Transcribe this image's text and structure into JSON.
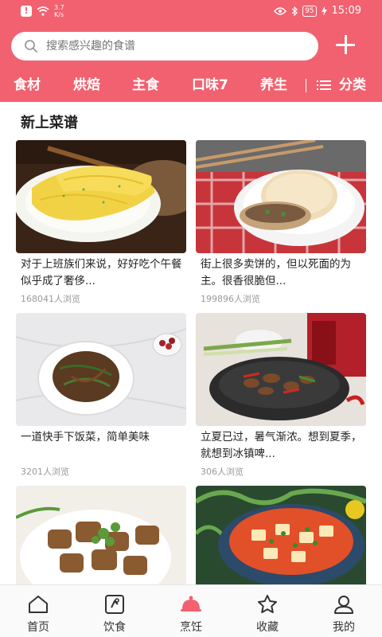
{
  "status_bar": {
    "speed_value": "3.7",
    "speed_unit": "K/s",
    "battery": "95",
    "time": "15:09"
  },
  "search": {
    "placeholder": "搜索感兴趣的食谱"
  },
  "tabs": [
    {
      "label": "食材"
    },
    {
      "label": "烘焙"
    },
    {
      "label": "主食"
    },
    {
      "label": "口味7"
    },
    {
      "label": "养生"
    }
  ],
  "category_label": "分类",
  "section_title": "新上菜谱",
  "recipes": [
    {
      "title": "对于上班族们来说，好好吃个午餐似乎成了奢侈...",
      "views": "168041人浏览"
    },
    {
      "title": "街上很多卖饼的，但以死面的为主。很香很脆但...",
      "views": "199896人浏览"
    },
    {
      "title": "一道快手下饭菜，简单美味",
      "views": "3201人浏览"
    },
    {
      "title": "立夏已过，暑气渐浓。想到夏季，就想到冰镇啤...",
      "views": "306人浏览"
    },
    {
      "title": "",
      "views": ""
    },
    {
      "title": "",
      "views": ""
    }
  ],
  "nav": [
    {
      "label": "首页"
    },
    {
      "label": "饮食"
    },
    {
      "label": "烹饪"
    },
    {
      "label": "收藏"
    },
    {
      "label": "我的"
    }
  ],
  "colors": {
    "brand": "#f2616f",
    "text": "#222222",
    "muted": "#999999"
  }
}
